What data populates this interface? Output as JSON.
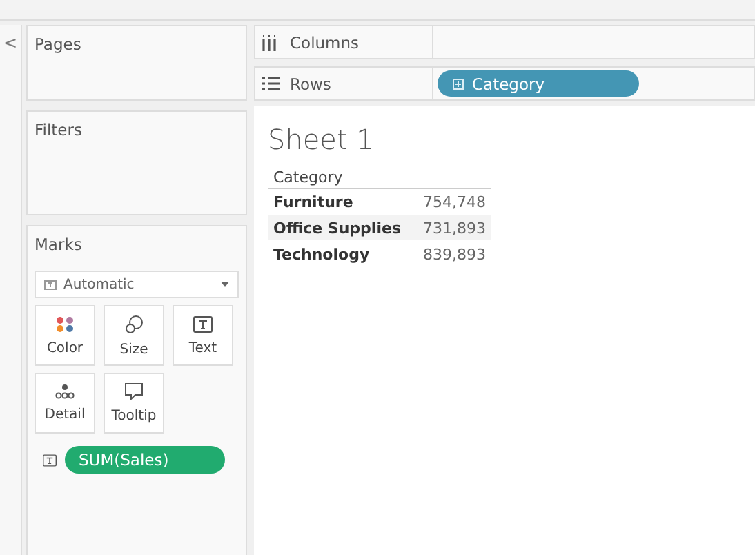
{
  "collapse_button": "<",
  "cards": [
    {
      "kind": "pages",
      "title": "Pages"
    },
    {
      "kind": "filters",
      "title": "Filters"
    }
  ],
  "marks": {
    "title": "Marks",
    "mark_type": "Automatic",
    "buttons": [
      {
        "kind": "color",
        "label": "Color"
      },
      {
        "kind": "size",
        "label": "Size"
      },
      {
        "kind": "text",
        "label": "Text"
      },
      {
        "kind": "detail",
        "label": "Detail"
      },
      {
        "kind": "tooltip",
        "label": "Tooltip"
      }
    ],
    "fields": [
      {
        "kind": "text",
        "pill": "SUM(Sales)"
      }
    ]
  },
  "shelves": [
    {
      "kind": "columns",
      "label": "Columns"
    },
    {
      "kind": "rows",
      "label": "Rows",
      "pills": [
        "Category"
      ]
    }
  ],
  "sheet": {
    "title": "Sheet 1",
    "header": "Category",
    "rows": [
      {
        "category": "Furniture",
        "value": "754,748"
      },
      {
        "category": "Office Supplies",
        "value": "731,893"
      },
      {
        "category": "Technology",
        "value": "839,893"
      }
    ]
  }
}
